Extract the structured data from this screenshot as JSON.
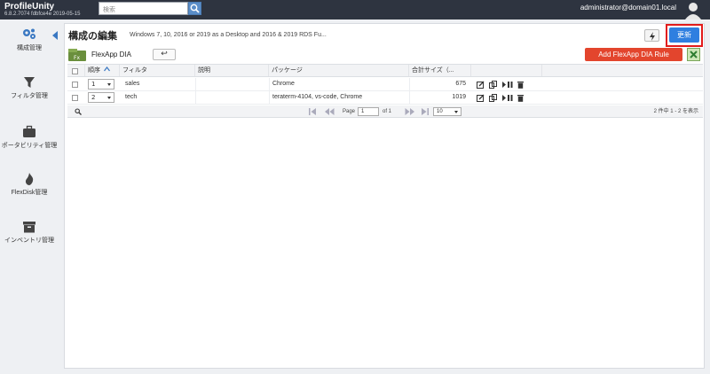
{
  "app": {
    "title": "ProfileUnity",
    "version": "6.8.2.7074 fdbfce4e 2019-05-15",
    "search_placeholder": "検索",
    "user": "administrator@domain01.local"
  },
  "sidebar": {
    "items": [
      {
        "label": "構成管理",
        "icon": "gears-icon"
      },
      {
        "label": "フィルタ管理",
        "icon": "filter-icon"
      },
      {
        "label": "ポータビリティ管理",
        "icon": "briefcase-icon"
      },
      {
        "label": "FlexDisk管理",
        "icon": "flame-icon"
      },
      {
        "label": "インベントリ管理",
        "icon": "inventory-box-icon"
      }
    ]
  },
  "header": {
    "title": "構成の編集",
    "description": "Windows 7, 10, 2016 or 2019 as a Desktop and 2016 & 2019 RDS Fu...",
    "update_label": "更新",
    "highlight_color": "#e21b1b",
    "accent_color": "#2f7fe0"
  },
  "section": {
    "title": "FlexApp DIA",
    "back_label": "↩",
    "add_label": "Add FlexApp DIA Rule"
  },
  "table": {
    "columns": [
      "順序",
      "フィルタ",
      "説明",
      "パッケージ",
      "合計サイズ（..."
    ],
    "rows": [
      {
        "order": "1",
        "filter": "sales",
        "description": "",
        "package": "Chrome",
        "size": "675"
      },
      {
        "order": "2",
        "filter": "tech",
        "description": "",
        "package": "teraterm-4104, vs-code, Chrome",
        "size": "1019"
      }
    ]
  },
  "pager": {
    "page_label": "Page",
    "page_value": "1",
    "of_label": "of 1",
    "page_size": "10",
    "summary": "2 件中 1 - 2 を表示"
  }
}
